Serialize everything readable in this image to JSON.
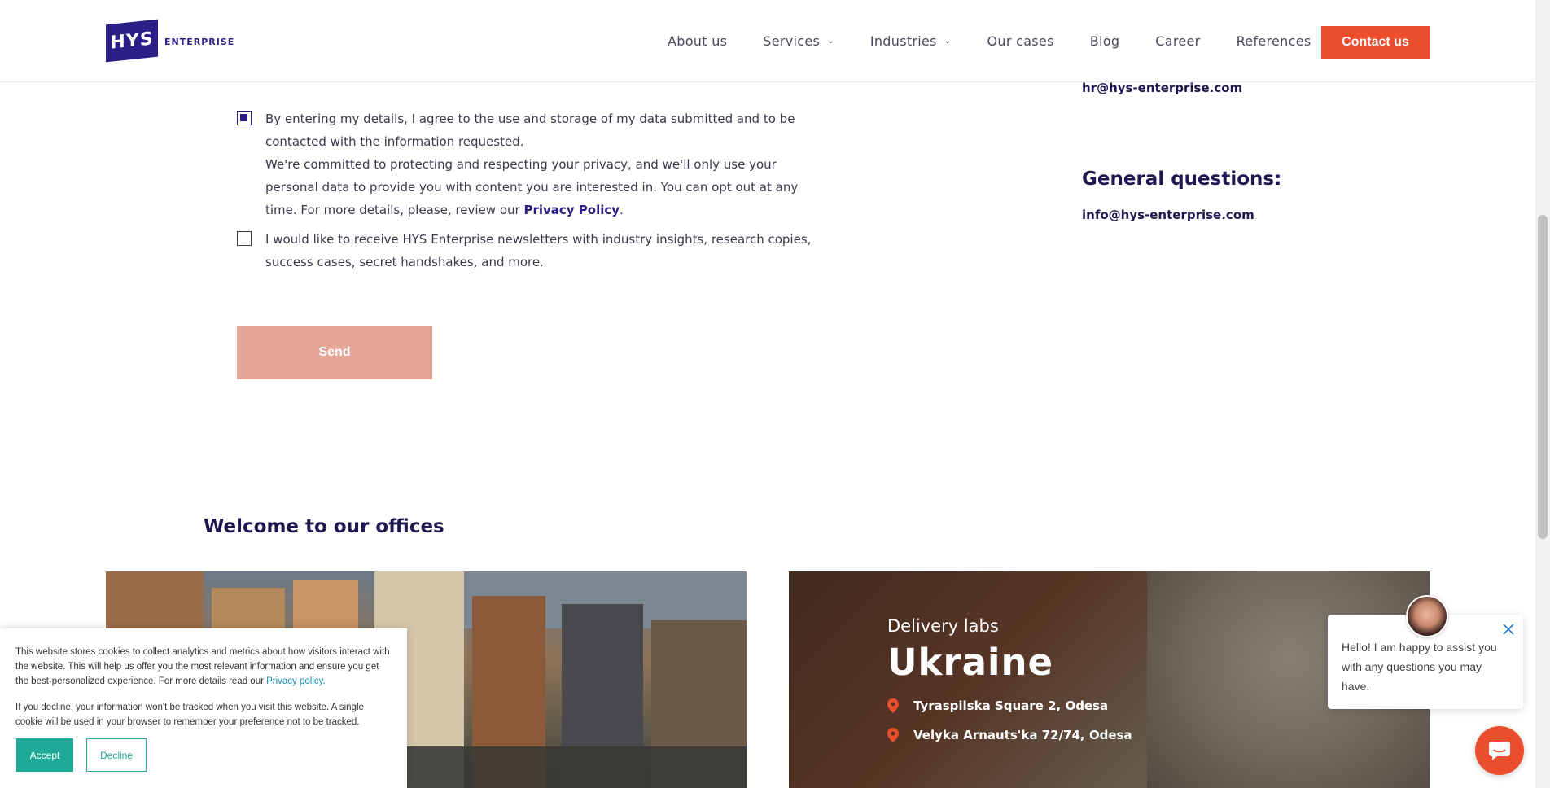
{
  "header": {
    "logo_mark": "HYS",
    "logo_text": "ENTERPRISE",
    "nav": [
      {
        "label": "About us",
        "has_dropdown": false
      },
      {
        "label": "Services",
        "has_dropdown": true
      },
      {
        "label": "Industries",
        "has_dropdown": true
      },
      {
        "label": "Our cases",
        "has_dropdown": false
      },
      {
        "label": "Blog",
        "has_dropdown": false
      },
      {
        "label": "Career",
        "has_dropdown": false
      },
      {
        "label": "References",
        "has_dropdown": false
      }
    ],
    "contact_label": "Contact us"
  },
  "form": {
    "consent_text_1": "By entering my details, I agree to the use and storage of my data submitted and to be contacted with the information requested.",
    "consent_text_2": "We're committed to protecting and respecting your privacy, and we'll only use your personal data to provide you with content you are interested in. You can opt out at any time. For more details, please, review our ",
    "privacy_link": "Privacy Policy",
    "consent_end": ".",
    "consent_checked": true,
    "newsletter_text": "I would like to receive HYS Enterprise newsletters with industry insights, research copies, success cases, secret handshakes, and more.",
    "newsletter_checked": false,
    "send_label": "Send"
  },
  "contacts": {
    "hr_email": "hr@hys-enterprise.com",
    "general_title": "General questions:",
    "general_email": "info@hys-enterprise.com"
  },
  "offices": {
    "title": "Welcome to our offices",
    "right": {
      "subtitle": "Delivery labs",
      "country": "Ukraine",
      "addresses": [
        "Tyraspilska Square 2, Odesa",
        "Velyka Arnauts'ka 72/74, Odesa"
      ]
    }
  },
  "cookie": {
    "text_1": "This website stores cookies to collect analytics and metrics about how visitors interact with the website. This will help us offer you the most relevant information and ensure you get the best-personalized experience. For more details read our ",
    "privacy_link": "Privacy policy.",
    "text_2": "If you decline, your information won't be tracked when you visit this website. A single cookie will be used in your browser to remember your preference not to be tracked.",
    "accept_label": "Accept",
    "decline_label": "Decline"
  },
  "chat": {
    "message": "Hello! I am happy to assist you with any questions you may have."
  },
  "colors": {
    "brand": "#2a1f86",
    "accent": "#ea4e2c",
    "send_disabled": "#e5a597",
    "cookie_accent": "#1eaa97"
  }
}
